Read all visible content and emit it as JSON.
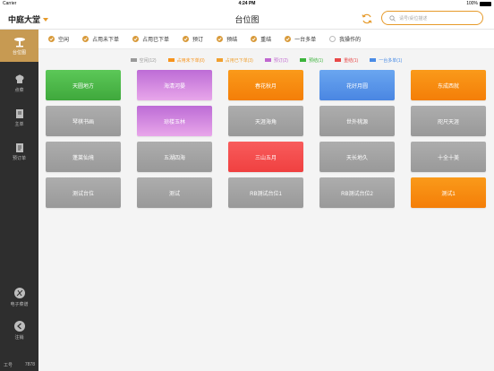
{
  "status_bar": {
    "carrier": "Carrier",
    "time": "4:24 PM",
    "battery": "100%"
  },
  "header": {
    "store_name": "中庭大堂",
    "title": "台位图",
    "search_placeholder": "请号/桌位描述",
    "icons": {
      "refresh": "refresh-icon",
      "search": "search-icon"
    }
  },
  "sidebar": {
    "items": [
      {
        "label": "台位图",
        "icon": "table-icon",
        "active": true
      },
      {
        "label": "点菜",
        "icon": "chef-icon",
        "active": false
      },
      {
        "label": "主单",
        "icon": "bill-icon",
        "active": false
      },
      {
        "label": "预订单",
        "icon": "booking-icon",
        "active": false
      }
    ],
    "bottom_items": [
      {
        "label": "电子菜谱",
        "icon": "menu-icon"
      },
      {
        "label": "注销",
        "icon": "logout-icon"
      }
    ],
    "footer_label": "工号",
    "footer_id": "7878"
  },
  "filters": [
    {
      "label": "空闲",
      "checked": true
    },
    {
      "label": "占用未下单",
      "checked": true
    },
    {
      "label": "占用已下单",
      "checked": true
    },
    {
      "label": "预订",
      "checked": true
    },
    {
      "label": "预结",
      "checked": true
    },
    {
      "label": "重结",
      "checked": true
    },
    {
      "label": "一台多单",
      "checked": true
    },
    {
      "label": "我操作的",
      "checked": false
    }
  ],
  "legend": [
    {
      "label": "空闲(12)",
      "color": "#9a9a9a"
    },
    {
      "label": "占用未下单(0)",
      "color": "#f7941d"
    },
    {
      "label": "占用已下单(3)",
      "color": "#f0a030"
    },
    {
      "label": "预订(2)",
      "color": "#c067d0"
    },
    {
      "label": "预结(1)",
      "color": "#3cb43c"
    },
    {
      "label": "重结(1)",
      "color": "#e84848"
    },
    {
      "label": "一台多单(1)",
      "color": "#4a8ce6"
    }
  ],
  "tables": [
    {
      "name": "天圆地方",
      "status": "green"
    },
    {
      "name": "海清河晏",
      "status": "purple"
    },
    {
      "name": "春花秋月",
      "status": "orange"
    },
    {
      "name": "花好月圆",
      "status": "blue"
    },
    {
      "name": "东成西就",
      "status": "orange"
    },
    {
      "name": "琴棋书画",
      "status": "gray"
    },
    {
      "name": "琼楼玉林",
      "status": "purple"
    },
    {
      "name": "天涯海角",
      "status": "gray"
    },
    {
      "name": "世外桃源",
      "status": "gray"
    },
    {
      "name": "咫尺天涯",
      "status": "gray"
    },
    {
      "name": "蓬莱仙境",
      "status": "gray"
    },
    {
      "name": "五湖四海",
      "status": "gray"
    },
    {
      "name": "三山五月",
      "status": "red"
    },
    {
      "name": "天长地久",
      "status": "gray"
    },
    {
      "name": "十全十美",
      "status": "gray"
    },
    {
      "name": "测试台位",
      "status": "gray"
    },
    {
      "name": "测试",
      "status": "gray"
    },
    {
      "name": "RB测试台位1",
      "status": "gray"
    },
    {
      "name": "RB测试台位2",
      "status": "gray"
    },
    {
      "name": "测试1",
      "status": "orange"
    }
  ],
  "colors": {
    "green": "#4cb848",
    "purple": "#cf7fdc",
    "orange": "#f8920e",
    "blue": "#5896ea",
    "gray": "#a3a3a3",
    "red": "#f44a4a",
    "accent": "#d89a3a"
  }
}
